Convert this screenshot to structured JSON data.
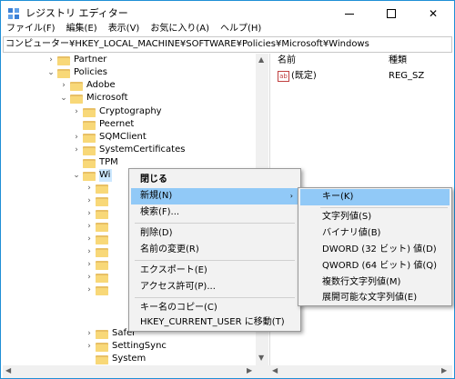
{
  "window": {
    "title": "レジストリ エディター",
    "minimize_glyph": "—",
    "close_glyph": "✕"
  },
  "menubar": [
    {
      "label": "ファイル(F)"
    },
    {
      "label": "編集(E)"
    },
    {
      "label": "表示(V)"
    },
    {
      "label": "お気に入り(A)"
    },
    {
      "label": "ヘルプ(H)"
    }
  ],
  "address": "コンピューター¥HKEY_LOCAL_MACHINE¥SOFTWARE¥Policies¥Microsoft¥Windows",
  "tree": {
    "items": [
      {
        "label": "Partner",
        "chevron": "›"
      },
      {
        "label": "Policies",
        "chevron": "⌄"
      },
      {
        "label": "Adobe",
        "chevron": "›"
      },
      {
        "label": "Microsoft",
        "chevron": "⌄"
      },
      {
        "label": "Cryptography",
        "chevron": "›"
      },
      {
        "label": "Peernet",
        "chevron": ""
      },
      {
        "label": "SQMClient",
        "chevron": "›"
      },
      {
        "label": "SystemCertificates",
        "chevron": "›"
      },
      {
        "label": "TPM",
        "chevron": ""
      },
      {
        "label": "Wi",
        "chevron": "⌄"
      },
      {
        "label": "Safer",
        "chevron": "›"
      },
      {
        "label": "SettingSync",
        "chevron": "›"
      },
      {
        "label": "System",
        "chevron": ""
      }
    ],
    "hidden_chevrons": [
      "›",
      "›",
      "›",
      "›",
      "›",
      "›",
      "›",
      "›",
      "›"
    ]
  },
  "list": {
    "headers": {
      "name": "名前",
      "type": "種類"
    },
    "rows": [
      {
        "icon": "ab",
        "name": "(既定)",
        "type": "REG_SZ"
      }
    ]
  },
  "context_menu": {
    "items": [
      {
        "label": "閉じる"
      },
      {
        "label": "新規(N)",
        "arrow": "›"
      },
      {
        "label": "検索(F)..."
      },
      {
        "label": "削除(D)"
      },
      {
        "label": "名前の変更(R)"
      },
      {
        "label": "エクスポート(E)"
      },
      {
        "label": "アクセス許可(P)..."
      },
      {
        "label": "キー名のコピー(C)"
      },
      {
        "label": "HKEY_CURRENT_USER に移動(T)"
      }
    ]
  },
  "submenu": {
    "items": [
      {
        "label": "キー(K)"
      },
      {
        "label": "文字列値(S)"
      },
      {
        "label": "バイナリ値(B)"
      },
      {
        "label": "DWORD (32 ビット) 値(D)"
      },
      {
        "label": "QWORD (64 ビット) 値(Q)"
      },
      {
        "label": "複数行文字列値(M)"
      },
      {
        "label": "展開可能な文字列値(E)"
      }
    ]
  },
  "colors": {
    "highlight": "#91c9f7",
    "selection": "#cce8ff",
    "folder": "#f8d878",
    "window_border": "#1f8fd6"
  }
}
